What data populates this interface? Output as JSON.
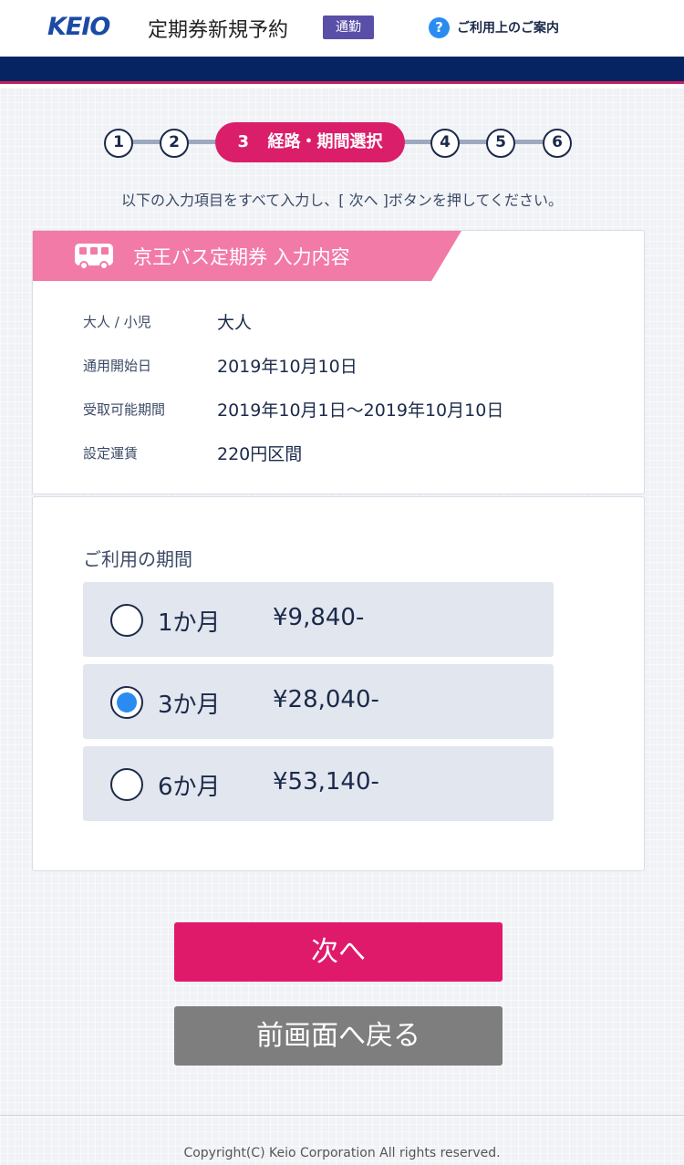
{
  "header": {
    "logo": "KEIO",
    "title": "定期券新規予約",
    "badge": "通勤",
    "help_label": "ご利用上のご案内"
  },
  "steps": {
    "items": [
      "1",
      "2",
      "3",
      "4",
      "5",
      "6"
    ],
    "active_index": 2,
    "active_number": "3",
    "active_label": "経路・期間選択"
  },
  "instruction": "以下の入力項目をすべて入力し、[ 次へ ]ボタンを押してください。",
  "summary": {
    "title": "京王バス定期券 入力内容",
    "icon": "bus-icon",
    "rows": [
      {
        "label": "大人 / 小児",
        "value": "大人"
      },
      {
        "label": "通用開始日",
        "value": "2019年10月10日"
      },
      {
        "label": "受取可能期間",
        "value": "2019年10月1日～2019年10月10日"
      },
      {
        "label": "設定運賃",
        "value": "220円区間"
      }
    ]
  },
  "period": {
    "heading": "ご利用の期間",
    "options": [
      {
        "months": "1か月",
        "price": "¥9,840-",
        "selected": false
      },
      {
        "months": "3か月",
        "price": "¥28,040-",
        "selected": true
      },
      {
        "months": "6か月",
        "price": "¥53,140-",
        "selected": false
      }
    ]
  },
  "buttons": {
    "next": "次へ",
    "back": "前画面へ戻る"
  },
  "footer": {
    "copyright": "Copyright(C) Keio Corporation All rights reserved."
  },
  "colors": {
    "brand_navy": "#062461",
    "accent_pink": "#e01a6a",
    "card_title_pink": "#f27aa6",
    "radio_selected": "#2a8cf0",
    "badge_purple": "#5a4fa8"
  }
}
